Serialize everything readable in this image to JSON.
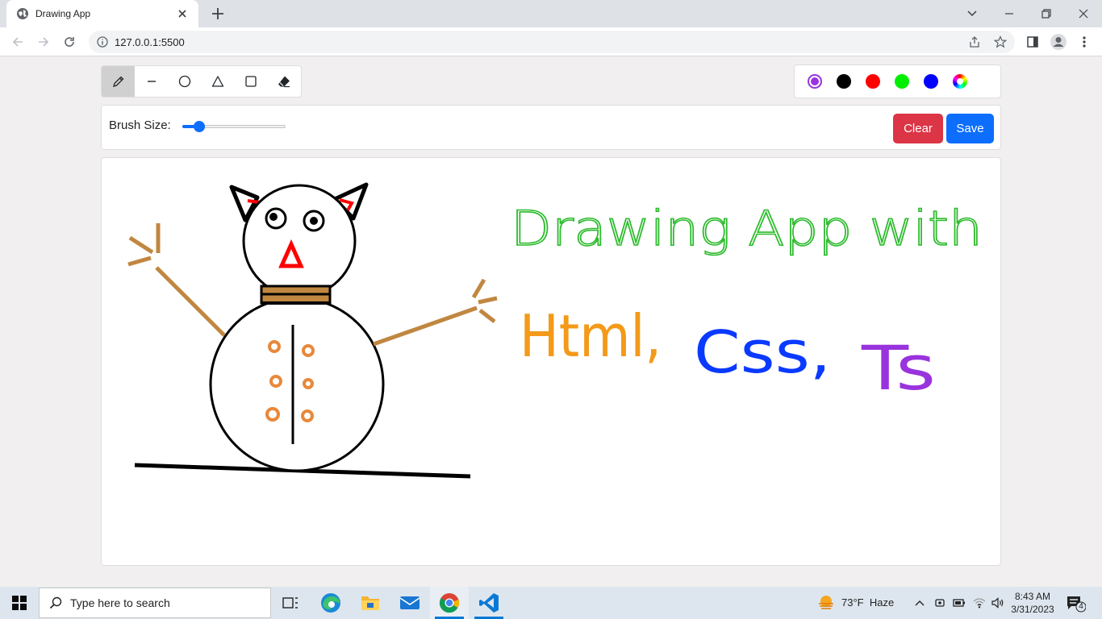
{
  "browser": {
    "tab_title": "Drawing App",
    "url": "127.0.0.1:5500"
  },
  "app": {
    "tools": [
      {
        "name": "brush",
        "icon": "pencil-icon",
        "active": true
      },
      {
        "name": "line",
        "icon": "line-icon",
        "active": false
      },
      {
        "name": "circle",
        "icon": "circle-icon",
        "active": false
      },
      {
        "name": "triangle",
        "icon": "triangle-icon",
        "active": false
      },
      {
        "name": "rectangle",
        "icon": "square-icon",
        "active": false
      },
      {
        "name": "eraser",
        "icon": "eraser-icon",
        "active": false
      }
    ],
    "colors": [
      "#9933dd",
      "#000000",
      "#ff0000",
      "#00ee00",
      "#0000ff",
      "rainbow-picker"
    ],
    "selected_color": "#9933dd",
    "brush_label": "Brush Size:",
    "brush_size_fraction": 0.17,
    "clear_label": "Clear",
    "save_label": "Save",
    "canvas_text": {
      "line1": "Drawing App with",
      "line2_html": "Html,",
      "line2_css": "Css,",
      "line2_ts": "Ts"
    }
  },
  "taskbar": {
    "search_placeholder": "Type here to search",
    "weather": "73°F  Haze",
    "time": "8:43 AM",
    "date": "3/31/2023",
    "notification_count": "4"
  }
}
